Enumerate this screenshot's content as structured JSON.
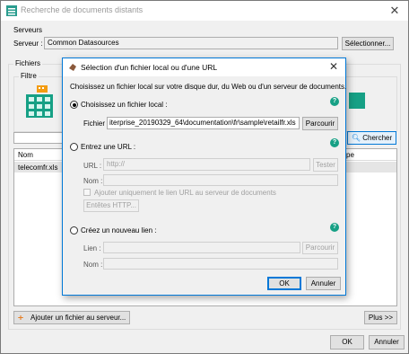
{
  "main_window": {
    "title": "Recherche de documents distants",
    "servers_group": "Serveurs",
    "server_label": "Serveur :",
    "server_value": "Common Datasources",
    "select_button": "Sélectionner...",
    "files_group": "Fichiers",
    "filter_group": "Filtre",
    "search_button": "Chercher",
    "columns": [
      "Nom",
      "pe"
    ],
    "rows": [
      [
        "telecomfr.xls"
      ]
    ],
    "add_file_button": "Ajouter un fichier au serveur...",
    "more_button": "Plus >>",
    "ok_button": "OK",
    "cancel_button": "Annuler"
  },
  "dialog": {
    "title": "Sélection d'un fichier local ou d'une URL",
    "description": "Choisissez un fichier local sur votre disque dur, du Web ou d'un serveur de documents.",
    "local_option": "Choisissez un fichier local :",
    "file_label": "Fichier :",
    "file_value": "iterprise_20190329_64\\documentation\\fr\\sample\\retailfr.xls",
    "browse_button": "Parcourir",
    "url_option": "Entrez une URL :",
    "url_label": "URL :",
    "url_value": "http://",
    "test_button": "Tester",
    "name_label": "Nom :",
    "add_url_checkbox": "Ajouter uniquement le lien URL au serveur de documents",
    "http_headers_button": "Entêtes HTTP...",
    "new_link_option": "Créez un nouveau lien :",
    "link_label": "Lien :",
    "link_browse_button": "Parcourir",
    "link_name_label": "Nom :",
    "ok_button": "OK",
    "cancel_button": "Annuler",
    "help_icon": "?"
  }
}
